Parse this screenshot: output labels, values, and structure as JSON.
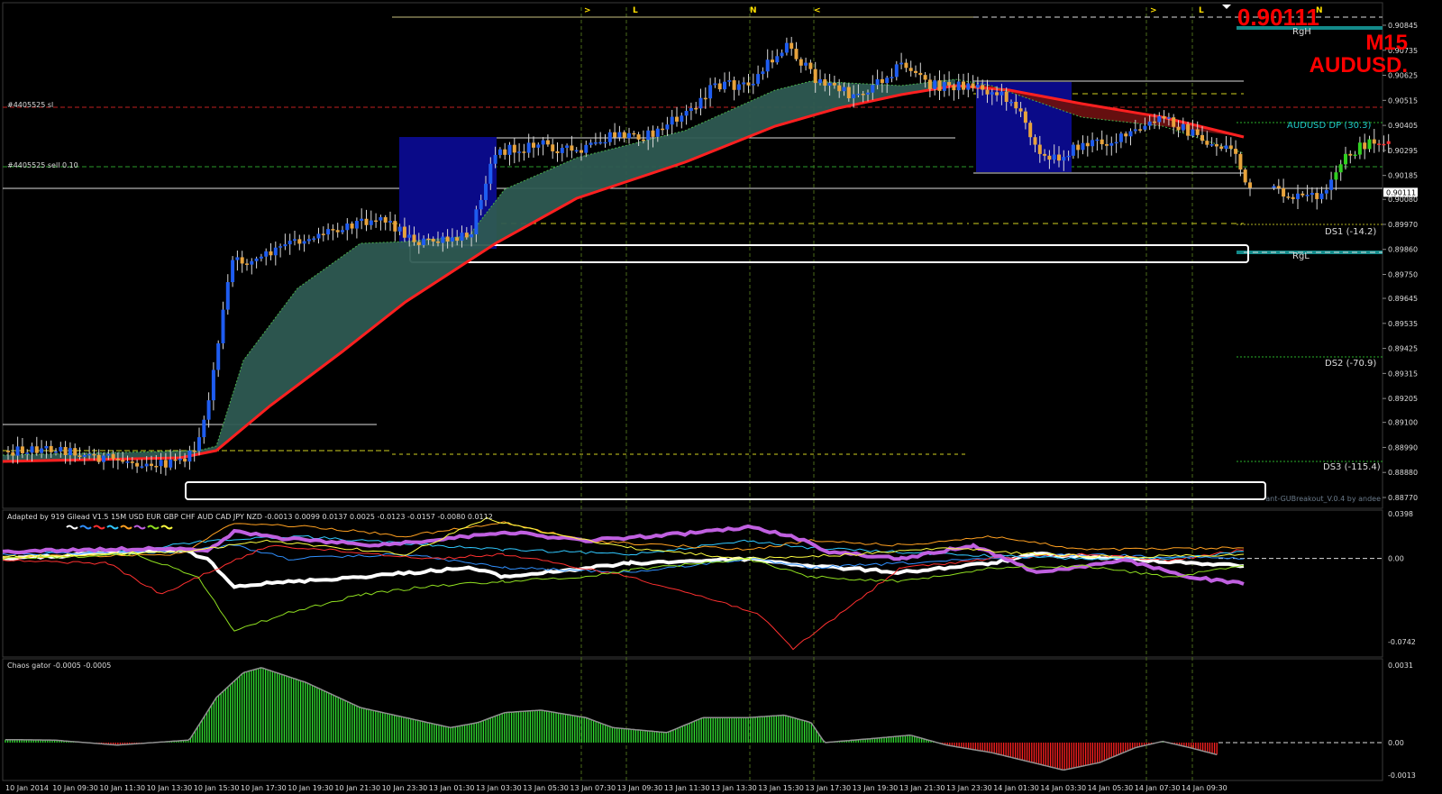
{
  "chart_data": [
    {
      "type": "candlestick",
      "symbol": "AUDUSD.",
      "timeframe": "M15",
      "current_price": "0.90111",
      "price_tag": "0.90111",
      "ylim": [
        0.8877,
        0.90845
      ],
      "y_ticks": [
        "0.90845",
        "0.90735",
        "0.90625",
        "0.90515",
        "0.90405",
        "0.90295",
        "0.90185",
        "0.90080",
        "0.89970",
        "0.89860",
        "0.89750",
        "0.89645",
        "0.89535",
        "0.89425",
        "0.89315",
        "0.89205",
        "0.89100",
        "0.88990",
        "0.88880",
        "0.88770"
      ],
      "x_ticks": [
        "10 Jan 2014",
        "10 Jan 09:30",
        "10 Jan 11:30",
        "10 Jan 13:30",
        "10 Jan 15:30",
        "10 Jan 17:30",
        "10 Jan 19:30",
        "10 Jan 21:30",
        "10 Jan 23:30",
        "13 Jan 01:30",
        "13 Jan 03:30",
        "13 Jan 05:30",
        "13 Jan 07:30",
        "13 Jan 09:30",
        "13 Jan 11:30",
        "13 Jan 13:30",
        "13 Jan 15:30",
        "13 Jan 17:30",
        "13 Jan 19:30",
        "13 Jan 21:30",
        "13 Jan 23:30",
        "14 Jan 01:30",
        "14 Jan 03:30",
        "14 Jan 05:30",
        "14 Jan 07:30",
        "14 Jan 09:30"
      ],
      "session_marks": [
        ">",
        "L",
        "N",
        "<",
        ">",
        "L",
        "N"
      ],
      "order_labels": [
        "#4405525 sl",
        "#4405525 sell 0.10"
      ],
      "level_labels": [
        "RgH",
        "AUDUSD DP (30.3)",
        "DS1 (-14.2)",
        "RgL",
        "DS2 (-70.9)",
        "DS3 (-115.4)"
      ],
      "indicator_credit": "ant-GUBreakout_V.0.4 by andee",
      "colors": {
        "up": "#1e5cf0",
        "down": "#e8a33c",
        "ma_red": "#ff2020",
        "band_fill": "#2e5a52",
        "box_blue": "#0a0a88",
        "level_teal": "#138a8a"
      }
    },
    {
      "type": "line",
      "title": "Adapted by 919 Gilead V1.5 15M USD EUR GBP CHF AUD CAD JPY NZD -0.0013 0.0099 0.0137 0.0025 -0.0123 -0.0157 -0.0080 0.0112",
      "series_names": [
        "USD",
        "EUR",
        "GBP",
        "CHF",
        "AUD",
        "CAD",
        "JPY",
        "NZD"
      ],
      "series_values": [
        -0.0013,
        0.0099,
        0.0137,
        0.0025,
        -0.0123,
        -0.0157,
        -0.008,
        0.0112
      ],
      "y_ticks": [
        "0.0398",
        "0.00",
        "-0.0742"
      ],
      "ylim": [
        -0.0742,
        0.0398
      ]
    },
    {
      "type": "bar",
      "title": "Chaos gator -0.0005 -0.0005",
      "y_ticks": [
        "0.0031",
        "0.00",
        "-0.0013"
      ],
      "ylim": [
        -0.0013,
        0.0031
      ]
    }
  ]
}
